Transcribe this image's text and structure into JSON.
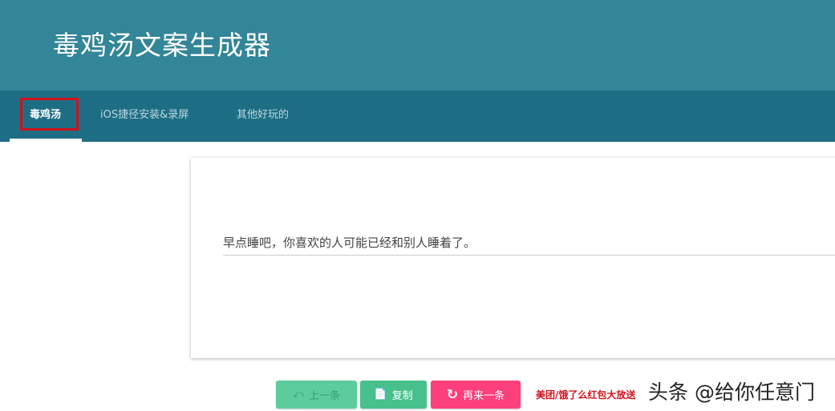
{
  "header": {
    "title": "毒鸡汤文案生成器"
  },
  "tabs": [
    {
      "label": "毒鸡汤"
    },
    {
      "label": "iOS捷径安装&录屏"
    },
    {
      "label": "其他好玩的"
    }
  ],
  "quote": "早点睡吧，你喜欢的人可能已经和别人睡着了。",
  "buttons": {
    "prev": "上一条",
    "copy": "复制",
    "again": "再来一条"
  },
  "ad": "美团/饿了么红包大放送",
  "watermark": "头条 @给你任意门",
  "colors": {
    "header": "#338598",
    "tabs": "#1d6e84",
    "green": "#47c08c",
    "pink": "#fd3f7b"
  }
}
